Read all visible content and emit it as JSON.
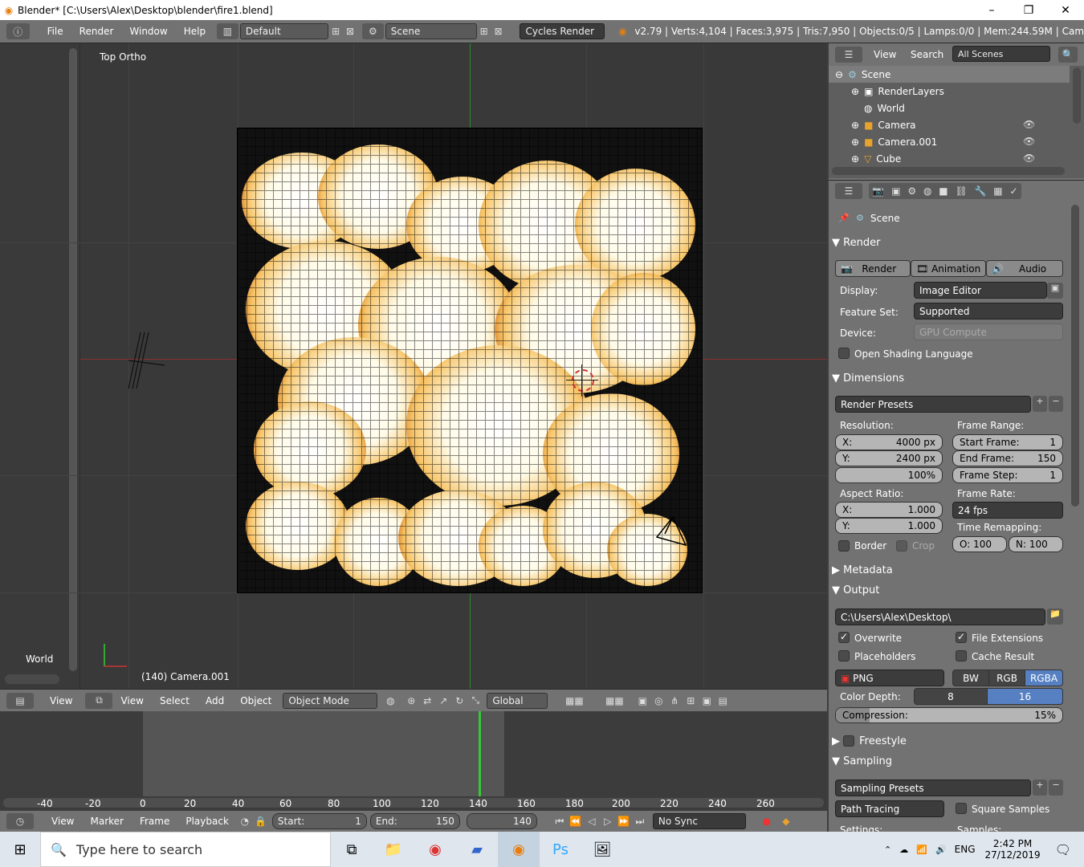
{
  "window": {
    "title": "Blender* [C:\\Users\\Alex\\Desktop\\blender\\fire1.blend]",
    "minimize": "–",
    "maximize": "❐",
    "close": "✕"
  },
  "infobar": {
    "menus": [
      "File",
      "Render",
      "Window",
      "Help"
    ],
    "layout": "Default",
    "scene": "Scene",
    "engine": "Cycles Render",
    "stats": "v2.79 | Verts:4,104 | Faces:3,975 | Tris:7,950 | Objects:0/5 | Lamps:0/0 | Mem:244.59M | Cam"
  },
  "viewport": {
    "view_label": "Top Ortho",
    "world_label": "World",
    "object_label": "(140) Camera.001"
  },
  "viewport_header": {
    "view": "View",
    "select": "Select",
    "add": "Add",
    "object": "Object",
    "mode": "Object Mode",
    "orientation": "Global",
    "left_view": "View"
  },
  "timeline": {
    "ticks": [
      "-40",
      "-20",
      "0",
      "20",
      "40",
      "60",
      "80",
      "100",
      "120",
      "140",
      "160",
      "180",
      "200",
      "220",
      "240",
      "260"
    ],
    "view": "View",
    "marker": "Marker",
    "frame": "Frame",
    "playback": "Playback",
    "start_label": "Start:",
    "start": "1",
    "end_label": "End:",
    "end": "150",
    "current": "140",
    "sync": "No Sync"
  },
  "outliner": {
    "view": "View",
    "search": "Search",
    "filter": "All Scenes",
    "items": [
      "Scene",
      "RenderLayers",
      "World",
      "Camera",
      "Camera.001",
      "Cube"
    ]
  },
  "properties": {
    "context": "Scene",
    "render": {
      "title": "Render",
      "render_btn": "Render",
      "animation_btn": "Animation",
      "audio_btn": "Audio",
      "display_label": "Display:",
      "display": "Image Editor",
      "feature_label": "Feature Set:",
      "feature": "Supported",
      "device_label": "Device:",
      "device": "GPU Compute",
      "osl": "Open Shading Language"
    },
    "dimensions": {
      "title": "Dimensions",
      "presets": "Render Presets",
      "resolution": "Resolution:",
      "res_x_label": "X:",
      "res_x": "4000 px",
      "res_y_label": "Y:",
      "res_y": "2400 px",
      "res_pct": "100%",
      "frame_range": "Frame Range:",
      "start_label": "Start Frame:",
      "start": "1",
      "end_label": "End Frame:",
      "end": "150",
      "step_label": "Frame Step:",
      "step": "1",
      "aspect": "Aspect Ratio:",
      "asp_x_label": "X:",
      "asp_x": "1.000",
      "asp_y_label": "Y:",
      "asp_y": "1.000",
      "frame_rate": "Frame Rate:",
      "fps": "24 fps",
      "time_remap": "Time Remapping:",
      "old": "O: 100",
      "new": "N: 100",
      "border": "Border",
      "crop": "Crop"
    },
    "metadata": {
      "title": "Metadata"
    },
    "output": {
      "title": "Output",
      "path": "C:\\Users\\Alex\\Desktop\\",
      "overwrite": "Overwrite",
      "file_ext": "File Extensions",
      "placeholders": "Placeholders",
      "cache": "Cache Result",
      "format": "PNG",
      "bw": "BW",
      "rgb": "RGB",
      "rgba": "RGBA",
      "depth_label": "Color Depth:",
      "depth_8": "8",
      "depth_16": "16",
      "compression_label": "Compression:",
      "compression": "15%",
      "compression_value": 0.15
    },
    "freestyle": {
      "title": "Freestyle"
    },
    "sampling": {
      "title": "Sampling",
      "presets": "Sampling Presets",
      "integrator": "Path Tracing",
      "square": "Square Samples",
      "settings": "Settings:",
      "samples": "Samples:"
    }
  },
  "taskbar": {
    "search_placeholder": "Type here to search",
    "time": "2:42 PM",
    "date": "27/12/2019",
    "lang": "ENG"
  },
  "colors": {
    "accent": "#5680c2",
    "header": "#727272",
    "viewport": "#393939",
    "timeline_marker": "#36c936"
  }
}
